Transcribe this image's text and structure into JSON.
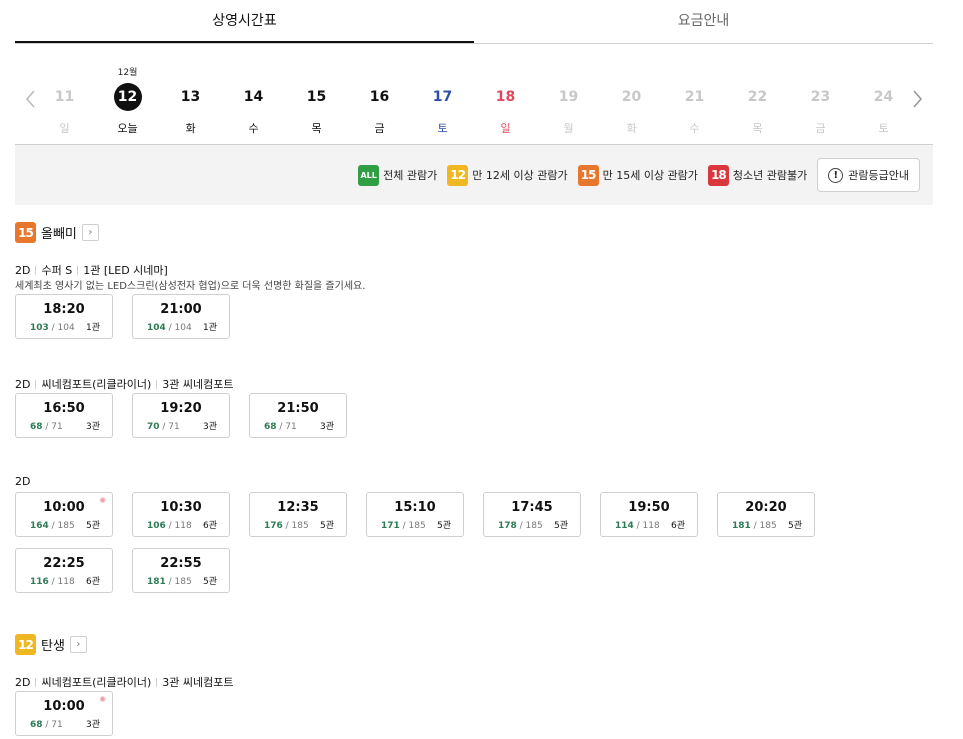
{
  "tabs": [
    {
      "label": "상영시간표",
      "active": true
    },
    {
      "label": "요금안내",
      "active": false
    }
  ],
  "date_strip": {
    "month_label": "12월",
    "days": [
      {
        "num": "11",
        "wd": "일",
        "state": "dis"
      },
      {
        "num": "12",
        "wd": "오늘",
        "state": "sel"
      },
      {
        "num": "13",
        "wd": "화",
        "state": "blk"
      },
      {
        "num": "14",
        "wd": "수",
        "state": "blk"
      },
      {
        "num": "15",
        "wd": "목",
        "state": "blk"
      },
      {
        "num": "16",
        "wd": "금",
        "state": "blk"
      },
      {
        "num": "17",
        "wd": "토",
        "state": "blu"
      },
      {
        "num": "18",
        "wd": "일",
        "state": "red"
      },
      {
        "num": "19",
        "wd": "월",
        "state": "dis"
      },
      {
        "num": "20",
        "wd": "화",
        "state": "dis"
      },
      {
        "num": "21",
        "wd": "수",
        "state": "dis"
      },
      {
        "num": "22",
        "wd": "목",
        "state": "dis"
      },
      {
        "num": "23",
        "wd": "금",
        "state": "dis"
      },
      {
        "num": "24",
        "wd": "토",
        "state": "dis"
      }
    ]
  },
  "legend": {
    "items": [
      {
        "badge": "ALL",
        "cls": "b-all",
        "label": "전체 관람가"
      },
      {
        "badge": "12",
        "cls": "b-12",
        "label": "만 12세 이상 관람가"
      },
      {
        "badge": "15",
        "cls": "b-15",
        "label": "만 15세 이상 관람가"
      },
      {
        "badge": "18",
        "cls": "b-18",
        "label": "청소년 관람불가"
      }
    ],
    "guide_button": "관람등급안내"
  },
  "movies": [
    {
      "title": "올빼미",
      "rating": "15",
      "screens": [
        {
          "format": "2D",
          "type": "수퍼 S",
          "hall": "1관 [LED 시네마]",
          "desc": "세계최초 영사기 없는 LED스크린(삼성전자 협업)으로 더욱 선명한 화질을 즐기세요.",
          "slots": [
            {
              "time": "18:20",
              "rem": "103",
              "total": "104",
              "hall": "1관"
            },
            {
              "time": "21:00",
              "rem": "104",
              "total": "104",
              "hall": "1관"
            }
          ]
        },
        {
          "format": "2D",
          "type": "씨네컴포트(리클라이너)",
          "hall": "3관 씨네컴포트",
          "slots": [
            {
              "time": "16:50",
              "rem": "68",
              "total": "71",
              "hall": "3관"
            },
            {
              "time": "19:20",
              "rem": "70",
              "total": "71",
              "hall": "3관"
            },
            {
              "time": "21:50",
              "rem": "68",
              "total": "71",
              "hall": "3관"
            }
          ]
        },
        {
          "format": "2D",
          "slots": [
            {
              "time": "10:00",
              "rem": "164",
              "total": "185",
              "hall": "5관",
              "morning": true
            },
            {
              "time": "10:30",
              "rem": "106",
              "total": "118",
              "hall": "6관"
            },
            {
              "time": "12:35",
              "rem": "176",
              "total": "185",
              "hall": "5관"
            },
            {
              "time": "15:10",
              "rem": "171",
              "total": "185",
              "hall": "5관"
            },
            {
              "time": "17:45",
              "rem": "178",
              "total": "185",
              "hall": "5관"
            },
            {
              "time": "19:50",
              "rem": "114",
              "total": "118",
              "hall": "6관"
            },
            {
              "time": "20:20",
              "rem": "181",
              "total": "185",
              "hall": "5관"
            },
            {
              "time": "22:25",
              "rem": "116",
              "total": "118",
              "hall": "6관"
            },
            {
              "time": "22:55",
              "rem": "181",
              "total": "185",
              "hall": "5관"
            }
          ]
        }
      ]
    },
    {
      "title": "탄생",
      "rating": "12",
      "screens": [
        {
          "format": "2D",
          "type": "씨네컴포트(리클라이너)",
          "hall": "3관 씨네컴포트",
          "slots": [
            {
              "time": "10:00",
              "rem": "68",
              "total": "71",
              "hall": "3관",
              "morning": true
            }
          ]
        }
      ]
    }
  ]
}
